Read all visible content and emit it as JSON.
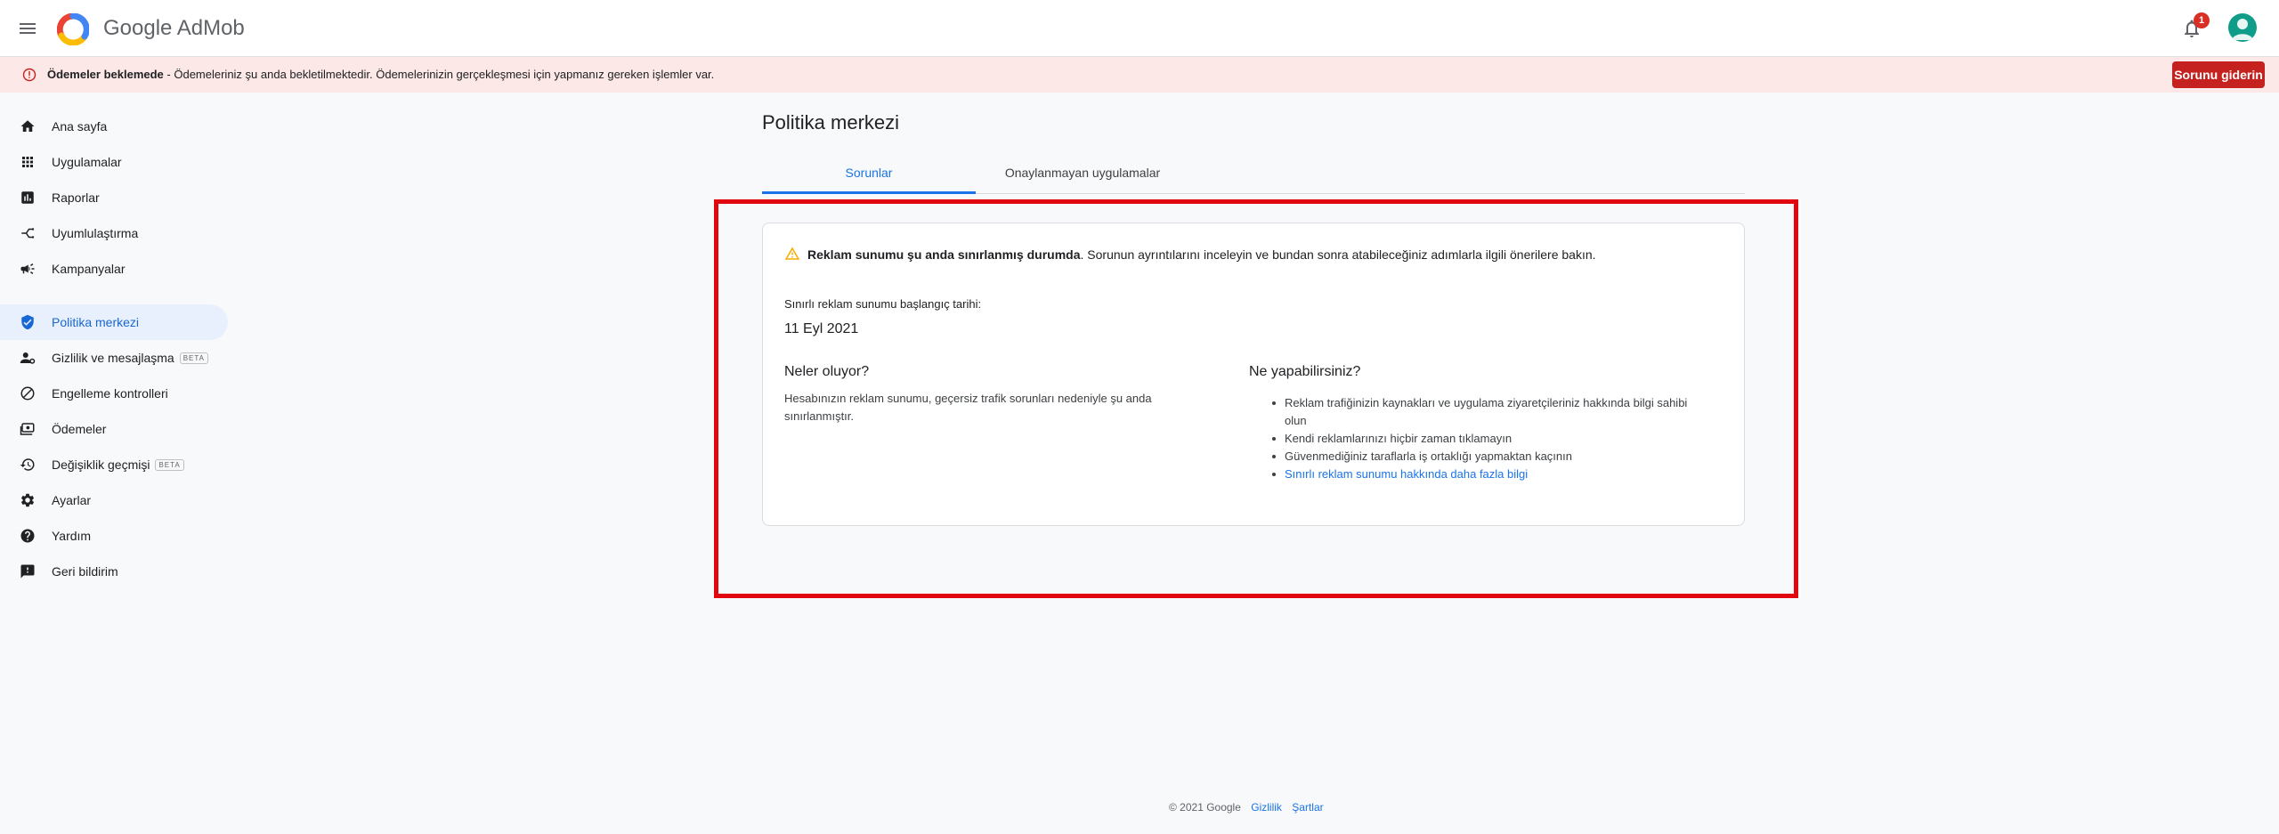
{
  "header": {
    "brand": "Google AdMob",
    "notification_count": "1"
  },
  "banner": {
    "bold_text": "Ödemeler beklemede",
    "text": " - Ödemeleriniz şu anda bekletilmektedir. Ödemelerinizin gerçekleşmesi için yapmanız gereken işlemler var.",
    "button_label": "Sorunu giderin"
  },
  "sidebar": {
    "items": [
      {
        "label": "Ana sayfa",
        "icon": "home-icon"
      },
      {
        "label": "Uygulamalar",
        "icon": "apps-icon"
      },
      {
        "label": "Raporlar",
        "icon": "reports-icon"
      },
      {
        "label": "Uyumlulaştırma",
        "icon": "mediation-icon"
      },
      {
        "label": "Kampanyalar",
        "icon": "campaign-icon"
      },
      {
        "label": "Politika merkezi",
        "icon": "shield-icon",
        "active": true
      },
      {
        "label": "Gizlilik ve mesajlaşma",
        "icon": "privacy-icon",
        "badge": "BETA"
      },
      {
        "label": "Engelleme kontrolleri",
        "icon": "block-icon"
      },
      {
        "label": "Ödemeler",
        "icon": "payments-icon"
      },
      {
        "label": "Değişiklik geçmişi",
        "icon": "history-icon",
        "badge": "BETA"
      },
      {
        "label": "Ayarlar",
        "icon": "gear-icon"
      },
      {
        "label": "Yardım",
        "icon": "help-icon"
      },
      {
        "label": "Geri bildirim",
        "icon": "feedback-icon"
      }
    ]
  },
  "main": {
    "title": "Politika merkezi",
    "tabs": [
      {
        "label": "Sorunlar"
      },
      {
        "label": "Onaylanmayan uygulamalar"
      }
    ],
    "card": {
      "warning_bold": "Reklam sunumu şu anda sınırlanmış durumda",
      "warning_text": ". Sorunun ayrıntılarını inceleyin ve bundan sonra atabileceğiniz adımlarla ilgili önerilere bakın.",
      "start_label": "Sınırlı reklam sunumu başlangıç tarihi:",
      "start_date": "11 Eyl 2021",
      "left_heading": "Neler oluyor?",
      "left_text": "Hesabınızın reklam sunumu, geçersiz trafik sorunları nedeniyle şu anda sınırlanmıştır.",
      "right_heading": "Ne yapabilirsiniz?",
      "actions": [
        "Reklam trafiğinizin kaynakları ve uygulama ziyaretçileriniz hakkında bilgi sahibi olun",
        "Kendi reklamlarınızı hiçbir zaman tıklamayın",
        "Güvenmediğiniz taraflarla iş ortaklığı yapmaktan kaçının"
      ],
      "learn_more": "Sınırlı reklam sunumu hakkında daha fazla bilgi"
    }
  },
  "footer": {
    "copyright": "© 2021 Google",
    "privacy": "Gizlilik",
    "terms": "Şartlar"
  },
  "colors": {
    "accent": "#1a73e8",
    "error": "#c5221f",
    "banner_bg": "#fce8e6",
    "highlight": "#e0070f",
    "warning": "#f9ab00"
  }
}
